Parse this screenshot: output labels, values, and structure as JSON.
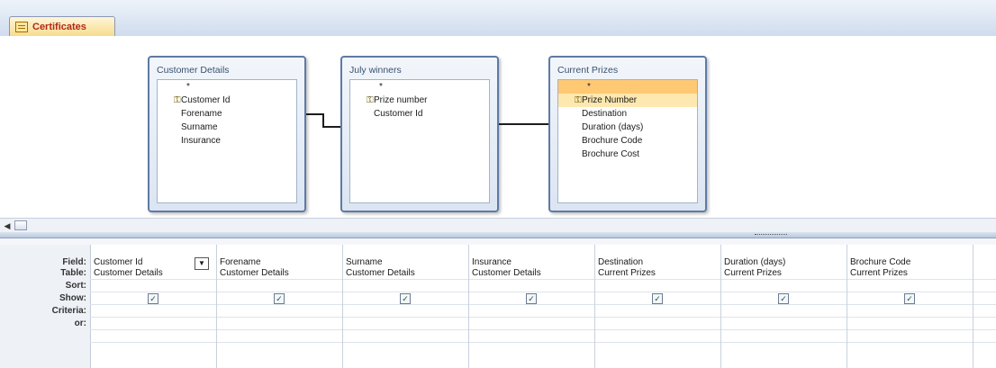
{
  "tab": {
    "title": "Certificates",
    "icon": "query-icon"
  },
  "tables": [
    {
      "title": "Customer Details",
      "fields": [
        "*",
        "Customer Id",
        "Forename",
        "Surname",
        "Insurance"
      ],
      "key_field": "Customer Id"
    },
    {
      "title": "July winners",
      "fields": [
        "*",
        "Prize number",
        "Customer Id"
      ],
      "key_field": "Prize number"
    },
    {
      "title": "Current Prizes",
      "fields": [
        "*",
        "Prize Number",
        "Destination",
        "Duration (days)",
        "Brochure Code",
        "Brochure Cost"
      ],
      "key_field": "Prize Number"
    }
  ],
  "grid": {
    "row_labels": [
      "Field:",
      "Table:",
      "Sort:",
      "Show:",
      "Criteria:",
      "or:"
    ],
    "columns": [
      {
        "field": "Customer Id",
        "table": "Customer Details",
        "show": true
      },
      {
        "field": "Forename",
        "table": "Customer Details",
        "show": true
      },
      {
        "field": "Surname",
        "table": "Customer Details",
        "show": true
      },
      {
        "field": "Insurance",
        "table": "Customer Details",
        "show": true
      },
      {
        "field": "Destination",
        "table": "Current Prizes",
        "show": true
      },
      {
        "field": "Duration (days)",
        "table": "Current Prizes",
        "show": true
      },
      {
        "field": "Brochure Code",
        "table": "Current Prizes",
        "show": true
      }
    ]
  },
  "checkmark": "✓",
  "key_glyph": "⚿",
  "scroll_left": "◀",
  "dropdown_glyph": "▼"
}
